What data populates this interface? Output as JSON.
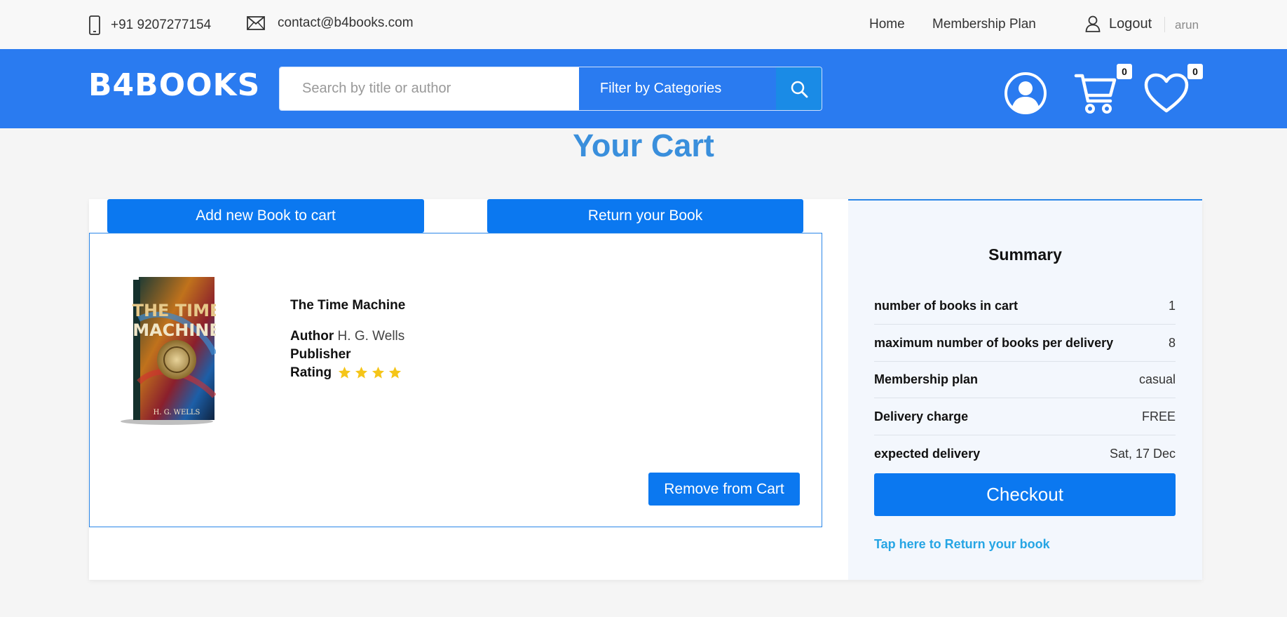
{
  "topbar": {
    "phone": "+91 9207277154",
    "email": "contact@b4books.com",
    "nav_home": "Home",
    "nav_membership": "Membership Plan",
    "logout": "Logout",
    "username": "arun"
  },
  "header": {
    "logo": "B4BOOKS",
    "search_placeholder": "Search by title or author",
    "filter_label": "Filter by Categories",
    "cart_count": "0",
    "wishlist_count": "0",
    "icons": [
      "phone-icon",
      "mail-icon",
      "user-outline-icon",
      "search-icon",
      "account-icon",
      "cart-icon",
      "heart-icon"
    ]
  },
  "page": {
    "title": "Your Cart"
  },
  "tabs": {
    "add": "Add new Book to cart",
    "return": "Return your Book"
  },
  "book": {
    "title": "The Time Machine",
    "author_label": "Author",
    "author": "H. G. Wells",
    "publisher_label": "Publisher",
    "rating_label": "Rating",
    "rating": 4,
    "cover_title_line1": "THE TIME",
    "cover_title_line2": "MACHINE",
    "cover_author": "H. G. WELLS",
    "remove_label": "Remove from Cart"
  },
  "summary": {
    "title": "Summary",
    "rows": [
      {
        "label": "number of books in cart",
        "value": "1"
      },
      {
        "label": "maximum number of books per delivery",
        "value": "8"
      },
      {
        "label": "Membership plan",
        "value": "casual"
      },
      {
        "label": "Delivery charge",
        "value": "FREE"
      },
      {
        "label": "expected delivery",
        "value": "Sat, 17 Dec"
      }
    ],
    "checkout_label": "Checkout",
    "return_link": "Tap here to Return your book"
  },
  "colors": {
    "brand_blue": "#2a7bf0",
    "button_blue": "#0b78f0",
    "title_blue": "#3a8fdc",
    "link_blue": "#26a5e4",
    "star": "#f5c518"
  }
}
